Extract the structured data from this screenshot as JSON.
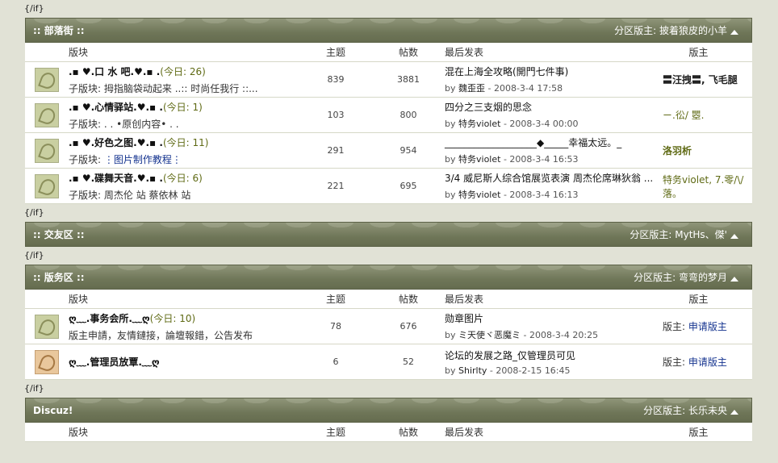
{
  "if_tag": "{/if}",
  "sections": [
    {
      "title": ":: 部落街 ::",
      "moderators_label": "分区版主:",
      "moderators": "披着狼皮的小羊",
      "columns": {
        "forum": "版块",
        "topics": "主题",
        "posts": "帖数",
        "last": "最后发表",
        "mods": "版主"
      },
      "rows": [
        {
          "name": ".▪ ♥.口 水 吧.♥.▪ .",
          "today": "(今日: 26)",
          "sub_label": "子版块:",
          "sub": "拇指脑袋动起来  ..:: 时尚任我行 ::...",
          "topics": "839",
          "posts": "3881",
          "last_title": "混在上海全攻略(開門七件事)",
          "last_by": "by",
          "last_user": "魏歪歪",
          "last_time": "- 2008-3-4 17:58",
          "mods": "〓汪拽〓, 飞毛腿"
        },
        {
          "name": ".▪ ♥.心情驿站.♥.▪ .",
          "today": "(今日: 1)",
          "sub_label": "子版块:",
          "sub": ". . •原创内容• . .",
          "topics": "103",
          "posts": "800",
          "last_title": "四分之三支烟的思念",
          "last_by": "by",
          "last_user": "特务violet",
          "last_time": "- 2008-3-4 00:00",
          "mods": "ㄧ.彸/ 瞾."
        },
        {
          "name": ".▪ ♥.好色之图.♥.▪ .",
          "today": "(今日: 11)",
          "sub_label": "子版块:",
          "sub": "⋮图片制作教程⋮",
          "topics": "291",
          "posts": "954",
          "last_title": "___________________◆_____幸福太远。_",
          "last_by": "by",
          "last_user": "特务violet",
          "last_time": "- 2008-3-4 16:53",
          "mods": "洛羽析"
        },
        {
          "name": ".▪ ♥.碟舞天音.♥.▪ .",
          "today": "(今日: 6)",
          "sub_label": "子版块:",
          "sub": "周杰伦 站  蔡依林 站",
          "topics": "221",
          "posts": "695",
          "last_title": "3/4 威尼斯人综合馆展览表演 周杰伦席琳狄翁 ...",
          "last_by": "by",
          "last_user": "特务violet",
          "last_time": "- 2008-3-4 16:13",
          "mods": "特务violet, 7.零/\\/落。"
        }
      ]
    },
    {
      "title": ":: 交友区 ::",
      "moderators_label": "分区版主:",
      "moderators": "MytHs、傑'"
    },
    {
      "title": ":: 版务区 ::",
      "moderators_label": "分区版主:",
      "moderators": "弯弯的梦月",
      "columns": {
        "forum": "版块",
        "topics": "主题",
        "posts": "帖数",
        "last": "最后发表",
        "mods": "版主"
      },
      "rows": [
        {
          "name": "ღ﹏.事务会所.﹏ღ",
          "today": "(今日: 10)",
          "sub": "版主申請，友情鏈接，論壇報錯，公告发布",
          "topics": "78",
          "posts": "676",
          "last_title": "勋章图片",
          "last_by": "by",
          "last_user": "ミ天使ヾ恶魔ミ",
          "last_time": "- 2008-3-4 20:25",
          "mods_label": "版主:",
          "mods": "申请版主"
        },
        {
          "name": "ღ﹏.管理员放覃.﹏ღ",
          "today": "",
          "sub": "",
          "topics": "6",
          "posts": "52",
          "last_title": "论坛的发展之路_仅管理员可见",
          "last_by": "by",
          "last_user": "Shirlty",
          "last_time": "- 2008-2-15 16:45",
          "mods_label": "版主:",
          "mods": "申请版主"
        }
      ]
    },
    {
      "title": "Discuz!",
      "moderators_label": "分区版主:",
      "moderators": "长乐未央",
      "columns": {
        "forum": "版块",
        "topics": "主题",
        "posts": "帖数",
        "last": "最后发表",
        "mods": "版主"
      }
    }
  ]
}
